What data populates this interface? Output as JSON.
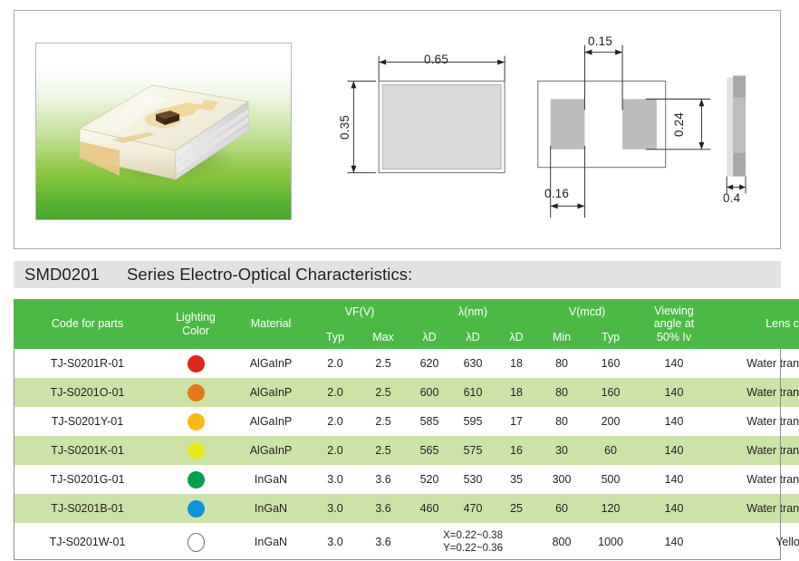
{
  "drawings": {
    "photo": {
      "alt_name": "smd0201-led-package-photo"
    },
    "top_view": {
      "width_label": "0.65",
      "height_label": "0.35"
    },
    "bottom_view": {
      "pad_gap_label": "0.15",
      "pad_width_label": "0.16",
      "pad_height_label": "0.24"
    },
    "side_view": {
      "thickness_label": "0.4"
    }
  },
  "section": {
    "code": "SMD0201",
    "rest": "Series  Electro-Optical Characteristics:"
  },
  "table": {
    "header": {
      "code": "Code for parts",
      "lighting_color": "Lighting\nColor",
      "material": "Material",
      "vf_group": "VF(V)",
      "vf_typ": "Typ",
      "vf_max": "Max",
      "lambda_group": "λ(nm)",
      "lambda_1": "λD",
      "lambda_2": "λD",
      "lambda_3": "λD",
      "v_group": "V(mcd)",
      "v_min": "Min",
      "v_typ": "Typ",
      "viewing_angle": "Viewing\nangle at\n50% Iv",
      "lens_color": "Lens color"
    },
    "rows": [
      {
        "code": "TJ-S0201R-01",
        "color_hex": "#dc2817",
        "color_name": "red",
        "material": "AlGaInP",
        "vf_typ": "2.0",
        "vf_max": "2.5",
        "lambda_1": "620",
        "lambda_2": "630",
        "lambda_3": "18",
        "v_min": "80",
        "v_typ": "160",
        "viewing_angle": "140",
        "lens_color": "Water transparent"
      },
      {
        "code": "TJ-S0201O-01",
        "color_hex": "#e8781a",
        "color_name": "orange",
        "material": "AlGaInP",
        "vf_typ": "2.0",
        "vf_max": "2.5",
        "lambda_1": "600",
        "lambda_2": "610",
        "lambda_3": "18",
        "v_min": "80",
        "v_typ": "160",
        "viewing_angle": "140",
        "lens_color": "Water transparent"
      },
      {
        "code": "TJ-S0201Y-01",
        "color_hex": "#fcb913",
        "color_name": "amber",
        "material": "AlGaInP",
        "vf_typ": "2.0",
        "vf_max": "2.5",
        "lambda_1": "585",
        "lambda_2": "595",
        "lambda_3": "17",
        "v_min": "80",
        "v_typ": "200",
        "viewing_angle": "140",
        "lens_color": "Water transparent"
      },
      {
        "code": "TJ-S0201K-01",
        "color_hex": "#e8e81e",
        "color_name": "yellow",
        "material": "AlGaInP",
        "vf_typ": "2.0",
        "vf_max": "2.5",
        "lambda_1": "565",
        "lambda_2": "575",
        "lambda_3": "16",
        "v_min": "30",
        "v_typ": "60",
        "viewing_angle": "140",
        "lens_color": "Water transparent"
      },
      {
        "code": "TJ-S0201G-01",
        "color_hex": "#00a04a",
        "color_name": "green",
        "material": "InGaN",
        "vf_typ": "3.0",
        "vf_max": "3.6",
        "lambda_1": "520",
        "lambda_2": "530",
        "lambda_3": "35",
        "v_min": "300",
        "v_typ": "500",
        "viewing_angle": "140",
        "lens_color": "Water transparent"
      },
      {
        "code": "TJ-S0201B-01",
        "color_hex": "#0e93d8",
        "color_name": "blue",
        "material": "InGaN",
        "vf_typ": "3.0",
        "vf_max": "3.6",
        "lambda_1": "460",
        "lambda_2": "470",
        "lambda_3": "25",
        "v_min": "60",
        "v_typ": "120",
        "viewing_angle": "140",
        "lens_color": "Water transparent"
      },
      {
        "code": "TJ-S0201W-01",
        "color_hex": "#ffffff",
        "color_name": "white",
        "material": "InGaN",
        "vf_typ": "3.0",
        "vf_max": "3.6",
        "chromaticity": "X=0.22~0.38\nY=0.22~0.36",
        "v_min": "800",
        "v_typ": "1000",
        "viewing_angle": "140",
        "lens_color": "Yellow"
      }
    ]
  },
  "colors": {
    "header_green": "#4cb947",
    "row_alt_green": "#cde2a6",
    "title_bar_grey": "#e2e2e0",
    "border_grey": "#8d8f91"
  }
}
